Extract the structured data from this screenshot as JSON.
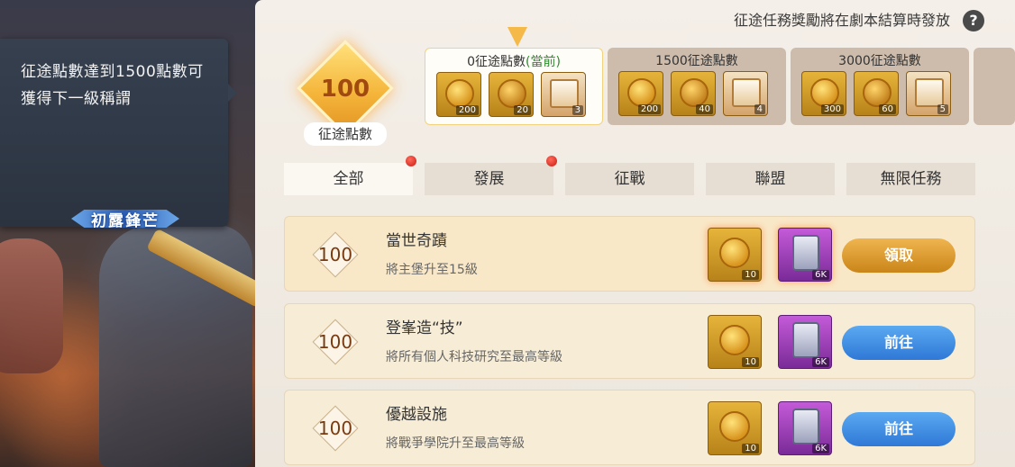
{
  "tooltip": {
    "line1": "征途點數達到1500點數可",
    "line2": "獲得下一級稱謂",
    "title_badge": "初露鋒芒"
  },
  "header": {
    "notice": "征途任務獎勵將在劇本結算時發放",
    "help_label": "?"
  },
  "points": {
    "value": "100",
    "label": "征途點數"
  },
  "tiers": [
    {
      "title": "0征途點數",
      "current": "(當前)",
      "items": [
        {
          "icon": "gold-coin-icon",
          "count": "200"
        },
        {
          "icon": "medal-icon",
          "count": "20"
        },
        {
          "icon": "card-icon",
          "count": "3"
        }
      ]
    },
    {
      "title": "1500征途點數",
      "current": "",
      "items": [
        {
          "icon": "gold-coin-icon",
          "count": "200"
        },
        {
          "icon": "medal-icon",
          "count": "40"
        },
        {
          "icon": "card-icon",
          "count": "4"
        }
      ]
    },
    {
      "title": "3000征途點數",
      "current": "",
      "items": [
        {
          "icon": "gold-coin-icon",
          "count": "300"
        },
        {
          "icon": "medal-icon",
          "count": "60"
        },
        {
          "icon": "card-icon",
          "count": "5"
        }
      ]
    }
  ],
  "tabs": [
    {
      "label": "全部",
      "dot": true
    },
    {
      "label": "發展",
      "dot": true
    },
    {
      "label": "征戰",
      "dot": false
    },
    {
      "label": "聯盟",
      "dot": false
    },
    {
      "label": "無限任務",
      "dot": false
    }
  ],
  "quests": [
    {
      "points": "100",
      "title": "當世奇蹟",
      "desc": "將主堡升至15級",
      "reward1": "10",
      "reward2": "6K",
      "button": "領取"
    },
    {
      "points": "100",
      "title": "登峯造“技”",
      "desc": "將所有個人科技研究至最高等級",
      "reward1": "10",
      "reward2": "6K",
      "button": "前往"
    },
    {
      "points": "100",
      "title": "優越設施",
      "desc": "將戰爭學院升至最高等級",
      "reward1": "10",
      "reward2": "6K",
      "button": "前往"
    }
  ],
  "colors": {
    "claim_button": "#e0a030",
    "go_button": "#3f8ee2",
    "notification_dot": "#d8261b"
  }
}
